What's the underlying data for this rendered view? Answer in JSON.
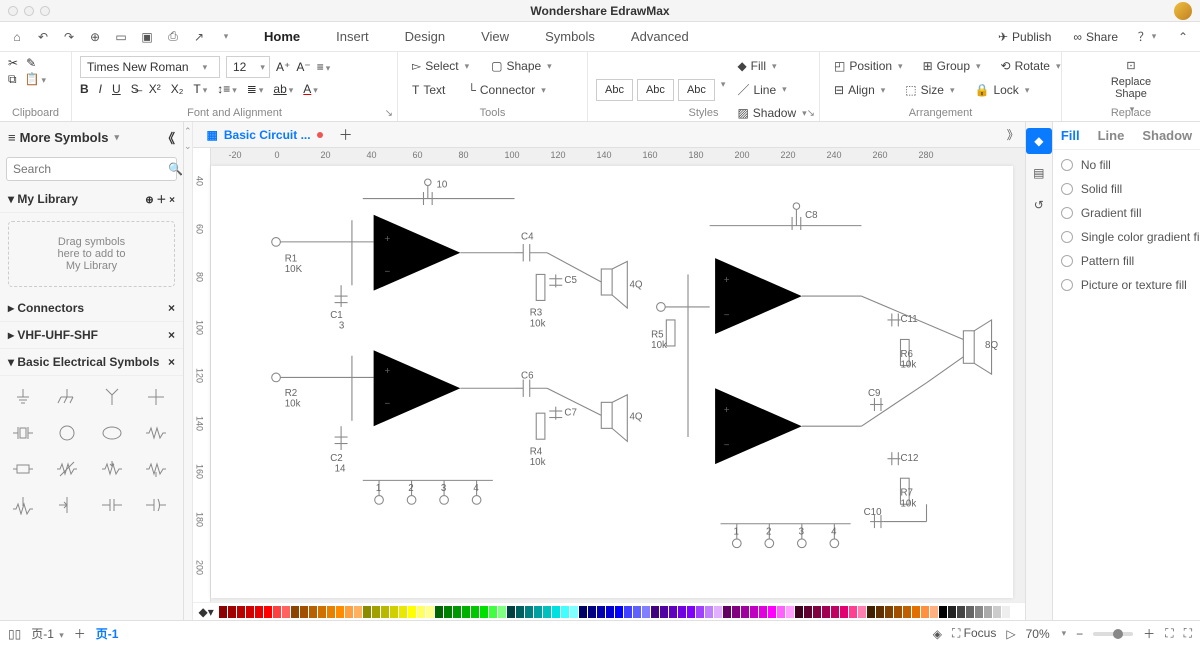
{
  "app": {
    "title": "Wondershare EdrawMax"
  },
  "menubar": {
    "tabs": [
      "Home",
      "Insert",
      "Design",
      "View",
      "Symbols",
      "Advanced"
    ],
    "active": 0,
    "publish": "Publish",
    "share": "Share"
  },
  "ribbon": {
    "clipboard": {
      "label": "Clipboard"
    },
    "font": {
      "label": "Font and Alignment",
      "family": "Times New Roman",
      "size": "12"
    },
    "tools": {
      "label": "Tools",
      "select": "Select",
      "shape": "Shape",
      "text": "Text",
      "connector": "Connector"
    },
    "styles": {
      "label": "Styles",
      "abc": "Abc",
      "fill": "Fill",
      "line": "Line",
      "shadow": "Shadow"
    },
    "arrangement": {
      "label": "Arrangement",
      "position": "Position",
      "group": "Group",
      "rotate": "Rotate",
      "align": "Align",
      "size": "Size",
      "lock": "Lock"
    },
    "replace": {
      "label": "Replace",
      "replace_shape": "Replace\nShape"
    }
  },
  "leftpanel": {
    "more_symbols": "More Symbols",
    "search_placeholder": "Search",
    "my_library": "My Library",
    "dropzone": "Drag symbols\nhere to add to\nMy Library",
    "sections": [
      "Connectors",
      "VHF-UHF-SHF",
      "Basic Electrical Symbols"
    ]
  },
  "doc": {
    "tab_name": "Basic Circuit ..."
  },
  "ruler_h": [
    "-20",
    "0",
    "20",
    "40",
    "60",
    "80",
    "100",
    "120",
    "140",
    "160",
    "180",
    "200",
    "220",
    "240",
    "260",
    "280"
  ],
  "ruler_v": [
    "40",
    "60",
    "80",
    "100",
    "120",
    "140",
    "160",
    "180",
    "200"
  ],
  "rightpanel": {
    "tabs": [
      "Fill",
      "Line",
      "Shadow"
    ],
    "active": 0,
    "options": [
      "No fill",
      "Solid fill",
      "Gradient fill",
      "Single color gradient fill",
      "Pattern fill",
      "Picture or texture fill"
    ]
  },
  "circuit_labels": {
    "c1": "C1",
    "c1v": "3",
    "c2": "C2",
    "c2v": "14",
    "c4": "C4",
    "c5": "C5",
    "c6": "C6",
    "c7": "C7",
    "c8": "C8",
    "c9": "C9",
    "c10": "C10",
    "c11": "C11",
    "c12": "C12",
    "r1": "R1",
    "r1v": "10K",
    "r2": "R2",
    "r2v": "10k",
    "r3": "R3",
    "r3v": "10k",
    "r4": "R4",
    "r4v": "10k",
    "r5": "R5",
    "r5v": "10k",
    "r6": "R6",
    "r6v": "10k",
    "r7": "R7",
    "r7v": "10k",
    "sp1": "4Q",
    "sp2": "4Q",
    "sp3": "8Q",
    "top10": "10",
    "b1": "1",
    "b2": "2",
    "b3": "3",
    "b4": "4",
    "b5": "1",
    "b6": "2",
    "b7": "3",
    "b8": "4"
  },
  "colorbar_colors": [
    "#8b0000",
    "#a00000",
    "#b80000",
    "#d00000",
    "#e80000",
    "#ff0000",
    "#ff4040",
    "#ff6060",
    "#8b4500",
    "#a05000",
    "#b86000",
    "#d07000",
    "#e88000",
    "#ff8c00",
    "#ffa040",
    "#ffb060",
    "#8b8b00",
    "#a0a000",
    "#b8b800",
    "#d0d000",
    "#e8e800",
    "#ffff00",
    "#ffff60",
    "#ffff90",
    "#006400",
    "#008000",
    "#009800",
    "#00b000",
    "#00c800",
    "#00e000",
    "#40ff40",
    "#80ff80",
    "#004040",
    "#006060",
    "#008080",
    "#00a0a0",
    "#00c0c0",
    "#00e0e0",
    "#40ffff",
    "#80ffff",
    "#000064",
    "#000080",
    "#0000b0",
    "#0000d0",
    "#0000ff",
    "#4040ff",
    "#6060ff",
    "#8080ff",
    "#400080",
    "#5000a0",
    "#6000c0",
    "#7000e0",
    "#8000ff",
    "#a040ff",
    "#c080ff",
    "#e0b0ff",
    "#640064",
    "#800080",
    "#a000a0",
    "#c000c0",
    "#e000e0",
    "#ff00ff",
    "#ff60ff",
    "#ffa0ff",
    "#400020",
    "#600030",
    "#800040",
    "#a00050",
    "#c00060",
    "#e00070",
    "#ff4090",
    "#ff80b0",
    "#402000",
    "#603000",
    "#804000",
    "#a05000",
    "#c06000",
    "#e07000",
    "#ff9040",
    "#ffb080",
    "#000",
    "#222",
    "#444",
    "#666",
    "#888",
    "#aaa",
    "#ccc",
    "#eee",
    "#fff"
  ],
  "status": {
    "page_label": "页-1",
    "tab_label": "页-1",
    "focus": "Focus",
    "zoom": "70%"
  }
}
